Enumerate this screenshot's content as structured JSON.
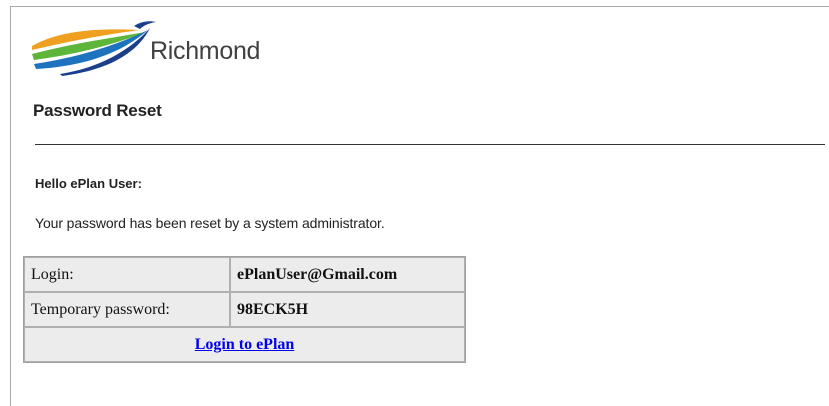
{
  "logo": {
    "text": "Richmond",
    "colors": {
      "orange": "#f0a020",
      "green": "#5db53a",
      "blue": "#1e73be",
      "navy": "#1b3f8b"
    }
  },
  "page": {
    "title": "Password Reset",
    "greeting": "Hello ePlan User:",
    "message": "Your password has been reset by a system administrator."
  },
  "credentials": {
    "login_label": "Login:",
    "login_value": "ePlanUser@Gmail.com",
    "temp_password_label": "Temporary password:",
    "temp_password_value": "98ECK5H",
    "login_link_text": "Login to ePlan"
  },
  "colors": {
    "link": "#0000ee",
    "table_bg": "#ececec"
  }
}
